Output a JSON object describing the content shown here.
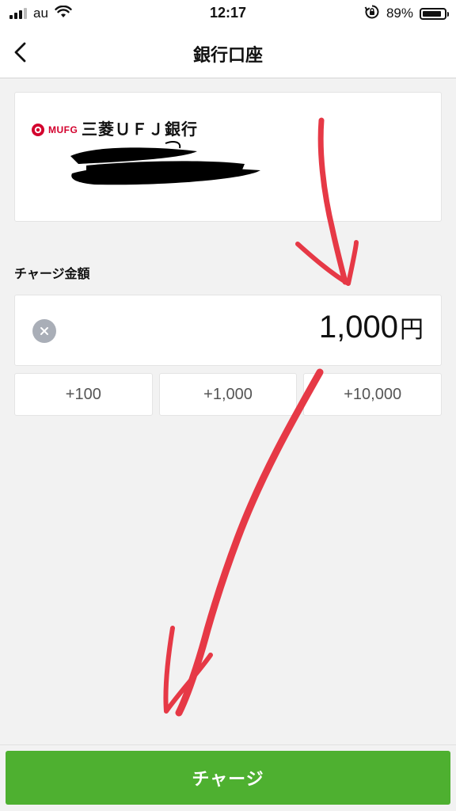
{
  "status_bar": {
    "carrier": "au",
    "time": "12:17",
    "battery_percent": "89%",
    "battery_level": 0.89,
    "icons": [
      "signal-icon",
      "wifi-icon",
      "orientation-lock-icon",
      "battery-icon"
    ]
  },
  "nav": {
    "title": "銀行口座",
    "back_icon": "chevron-left-icon"
  },
  "bank_account": {
    "logo_text": "MUFG",
    "bank_name": "三菱ＵＦＪ銀行",
    "logo_color": "#d3002d"
  },
  "charge": {
    "section_label": "チャージ金額",
    "amount": "1,000",
    "currency": "円",
    "clear_icon": "clear-icon",
    "quick_add": [
      {
        "label": "+100"
      },
      {
        "label": "+1,000"
      },
      {
        "label": "+10,000"
      }
    ],
    "submit_label": "チャージ"
  },
  "colors": {
    "background": "#f2f2f2",
    "card": "#ffffff",
    "primary": "#4eb030",
    "annotation": "#e63946",
    "clear_button": "#a9aeb7"
  }
}
